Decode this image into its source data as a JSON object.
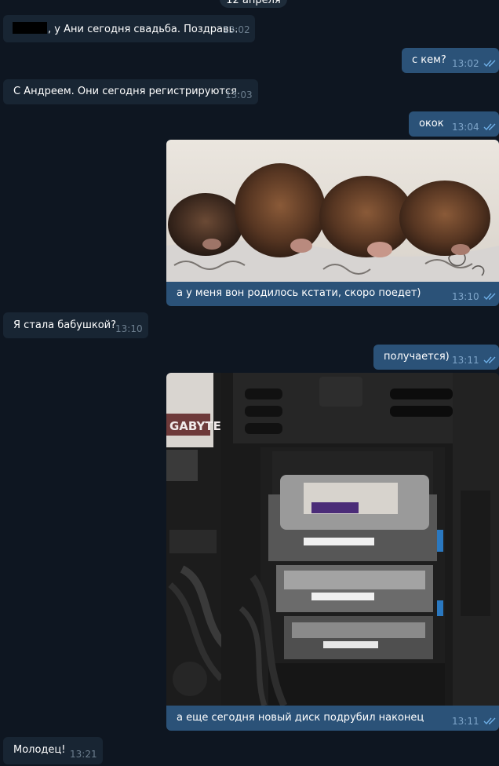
{
  "date_label": "12 апреля",
  "colors": {
    "background": "#0e1621",
    "incoming_bubble": "#182533",
    "outgoing_bubble": "#2b5278",
    "read_ticks": "#6fb0e8"
  },
  "messages": [
    {
      "direction": "in",
      "text": ", у Ани сегодня свадьба. Поздравь.",
      "time": "13:02",
      "has_redacted_name": true
    },
    {
      "direction": "out",
      "text": "с кем?",
      "time": "13:02",
      "status": "read"
    },
    {
      "direction": "in",
      "text": "С Андреем. Они сегодня регистрируются.",
      "time": "13:03"
    },
    {
      "direction": "out",
      "text": "окок",
      "time": "13:04",
      "status": "read"
    },
    {
      "direction": "out",
      "type": "photo",
      "photo": "four-sleeping-kittens",
      "caption": "а у меня вон родилось кстати, скоро поедет)",
      "time": "13:10",
      "status": "read"
    },
    {
      "direction": "in",
      "text": "Я стала бабушкой?",
      "time": "13:10"
    },
    {
      "direction": "out",
      "text": "получается)",
      "time": "13:11",
      "status": "read"
    },
    {
      "direction": "out",
      "type": "photo",
      "photo": "pc-case-with-hard-drives",
      "photo_text": "GABYTE",
      "caption": "а еще сегодня новый диск подрубил наконец",
      "time": "13:11",
      "status": "read"
    },
    {
      "direction": "in",
      "text": "Молодец!",
      "time": "13:21"
    }
  ]
}
